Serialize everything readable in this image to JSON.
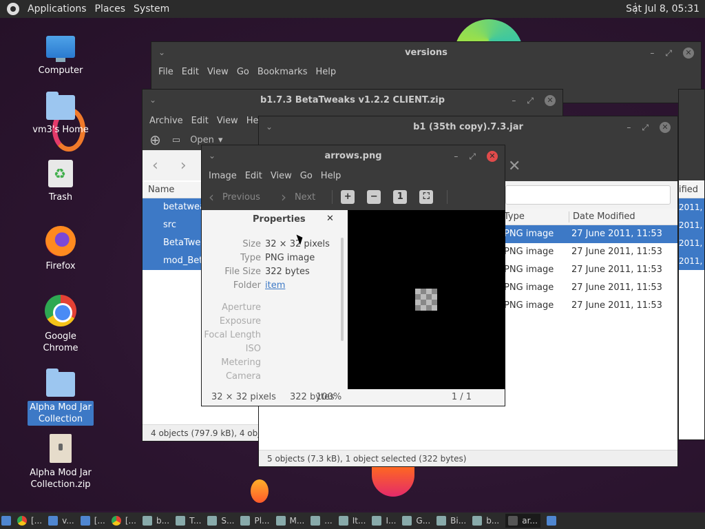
{
  "panel": {
    "menus": [
      "Applications",
      "Places",
      "System"
    ],
    "clock": "Sat Jul  8, 05:31"
  },
  "desktop": [
    {
      "label": "Computer"
    },
    {
      "label": "vm3's Home"
    },
    {
      "label": "Trash"
    },
    {
      "label": "Firefox"
    },
    {
      "label": "Google Chrome"
    },
    {
      "label": "Alpha Mod Jar Collection"
    },
    {
      "label": "Alpha Mod Jar Collection.zip"
    }
  ],
  "win_versions": {
    "title": "versions",
    "menus": [
      "File",
      "Edit",
      "View",
      "Go",
      "Bookmarks",
      "Help"
    ]
  },
  "win_archive": {
    "title": "b1.7.3 BetaTweaks v1.2.2 CLIENT.zip",
    "menus": [
      "Archive",
      "Edit",
      "View",
      "He"
    ],
    "open_label": "Open",
    "col_name": "Name",
    "rows": [
      "betatwea",
      "src",
      "BetaTwea",
      "mod_Bet"
    ],
    "status": "4 objects (797.9 kB), 4 obj"
  },
  "win_jar": {
    "title": "b1 (35th copy).7.3.jar",
    "col_type": "Type",
    "col_date": "Date Modified",
    "col_ified": "ified",
    "rows": [
      {
        "type": "PNG image",
        "date": "27 June 2011, 11:53"
      },
      {
        "type": "PNG image",
        "date": "27 June 2011, 11:53"
      },
      {
        "type": "PNG image",
        "date": "27 June 2011, 11:53"
      },
      {
        "type": "PNG image",
        "date": "27 June 2011, 11:53"
      },
      {
        "type": "PNG image",
        "date": "27 June 2011, 11:53"
      }
    ],
    "far_dates": [
      "2011, 2",
      "2011, 1",
      "2011, 2",
      "2011, 1"
    ],
    "status": "5 objects (7.3 kB), 1 object selected (322 bytes)"
  },
  "viewer": {
    "title": "arrows.png",
    "menus": [
      "Image",
      "Edit",
      "View",
      "Go",
      "Help"
    ],
    "prev": "Previous",
    "next": "Next",
    "props_title": "Properties",
    "props": [
      {
        "k": "Size",
        "v": "32 × 32 pixels"
      },
      {
        "k": "Type",
        "v": "PNG image"
      },
      {
        "k": "File Size",
        "v": "322 bytes"
      },
      {
        "k": "Folder",
        "v": "item"
      },
      {
        "k": "Aperture",
        "v": ""
      },
      {
        "k": "Exposure",
        "v": ""
      },
      {
        "k": "Focal Length",
        "v": ""
      },
      {
        "k": "ISO",
        "v": ""
      },
      {
        "k": "Metering",
        "v": ""
      },
      {
        "k": "Camera",
        "v": ""
      }
    ],
    "status_dim": "32 × 32 pixels",
    "status_size": "322 bytes",
    "status_zoom": "100%",
    "status_page": "1 / 1"
  },
  "taskbar": [
    "[...",
    "v...",
    "[...",
    "[...",
    "b...",
    "T...",
    "S...",
    "Pl...",
    "M...",
    "...",
    "It...",
    "I...",
    "G...",
    "Bi...",
    "b...",
    "ar..."
  ]
}
